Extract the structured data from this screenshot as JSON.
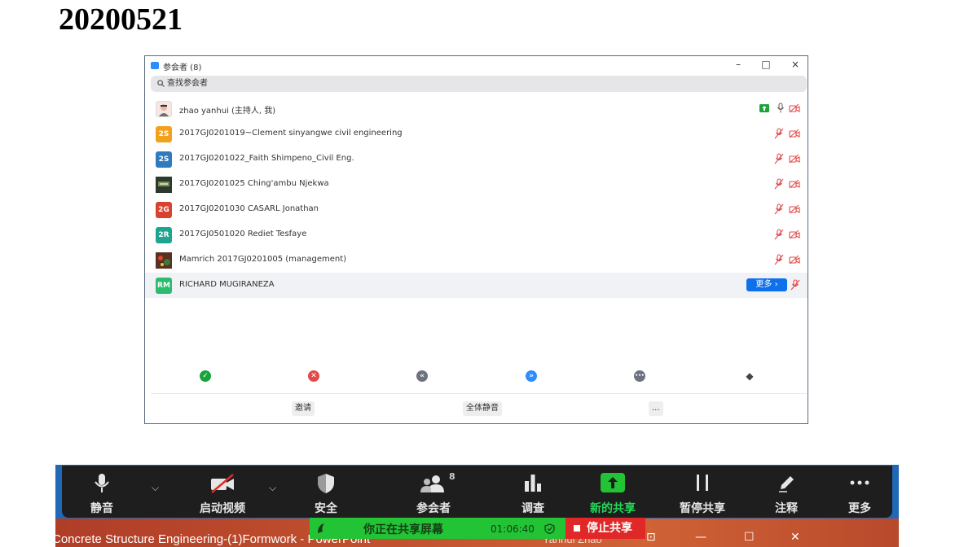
{
  "doc_title": "20200521",
  "window": {
    "title": "参会者 (8)",
    "controls": {
      "minimize": "–",
      "maximize": "□",
      "close": "×"
    },
    "search_placeholder": "查找参会者"
  },
  "participants": [
    {
      "name": "zhao yanhui (主持人, 我)",
      "avatar_type": "photo",
      "avatar_color": "#d9a59a"
    },
    {
      "name": "2017GJ0201019~Clement sinyangwe civil engineering",
      "avatar_text": "2S",
      "avatar_color": "#f2a01e"
    },
    {
      "name": "2017GJ0201022_Faith Shimpeno_Civil Eng.",
      "avatar_text": "2S",
      "avatar_color": "#2f7bbf"
    },
    {
      "name": "2017GJ0201025 Ching'ambu Njekwa",
      "avatar_type": "photo",
      "avatar_color": "#2b3a2a"
    },
    {
      "name": "2017GJ0201030 CASARL Jonathan",
      "avatar_text": "2G",
      "avatar_color": "#d8432f"
    },
    {
      "name": "2017GJ0501020 Rediet Tesfaye",
      "avatar_text": "2R",
      "avatar_color": "#1fa58e"
    },
    {
      "name": "Mamrich 2017GJ0201005 (management)",
      "avatar_type": "photo",
      "avatar_color": "#6b3a2a"
    },
    {
      "name": "RICHARD MUGIRANEZA",
      "avatar_text": "RM",
      "avatar_color": "#2dbb70",
      "more_label": "更多 ›"
    }
  ],
  "reactions": [
    {
      "name": "yes",
      "color": "#1aa33a",
      "glyph": "✓"
    },
    {
      "name": "no",
      "color": "#e24a4a",
      "glyph": "✕"
    },
    {
      "name": "slower",
      "color": "#6d7280",
      "glyph": "«"
    },
    {
      "name": "faster",
      "color": "#2d8cff",
      "glyph": "»"
    },
    {
      "name": "more",
      "color": "#6d7280",
      "glyph": "•••"
    },
    {
      "name": "clear",
      "color": "#444",
      "glyph": "◆"
    }
  ],
  "footer": {
    "invite": "邀请",
    "mute_all": "全体静音",
    "more": "..."
  },
  "toolbar": {
    "mute": "静音",
    "video": "启动视频",
    "security": "安全",
    "participants": "参会者",
    "participants_count": "8",
    "poll": "调查",
    "new_share": "新的共享",
    "pause_share": "暂停共享",
    "annotate": "注释",
    "more": "更多"
  },
  "share_bar": {
    "status": "你正在共享屏幕",
    "elapsed": "01:06:40",
    "stop": "停止共享"
  },
  "background_slide": {
    "title": "Concrete Structure Engineering-(1)Formwork  -  PowerPoint",
    "user": "Yanhui Zhao"
  },
  "colors": {
    "share_green": "#23c336",
    "stop_red": "#e02828",
    "toolbar_bg": "#1e1e1e",
    "accent_blue": "#0e71eb"
  }
}
